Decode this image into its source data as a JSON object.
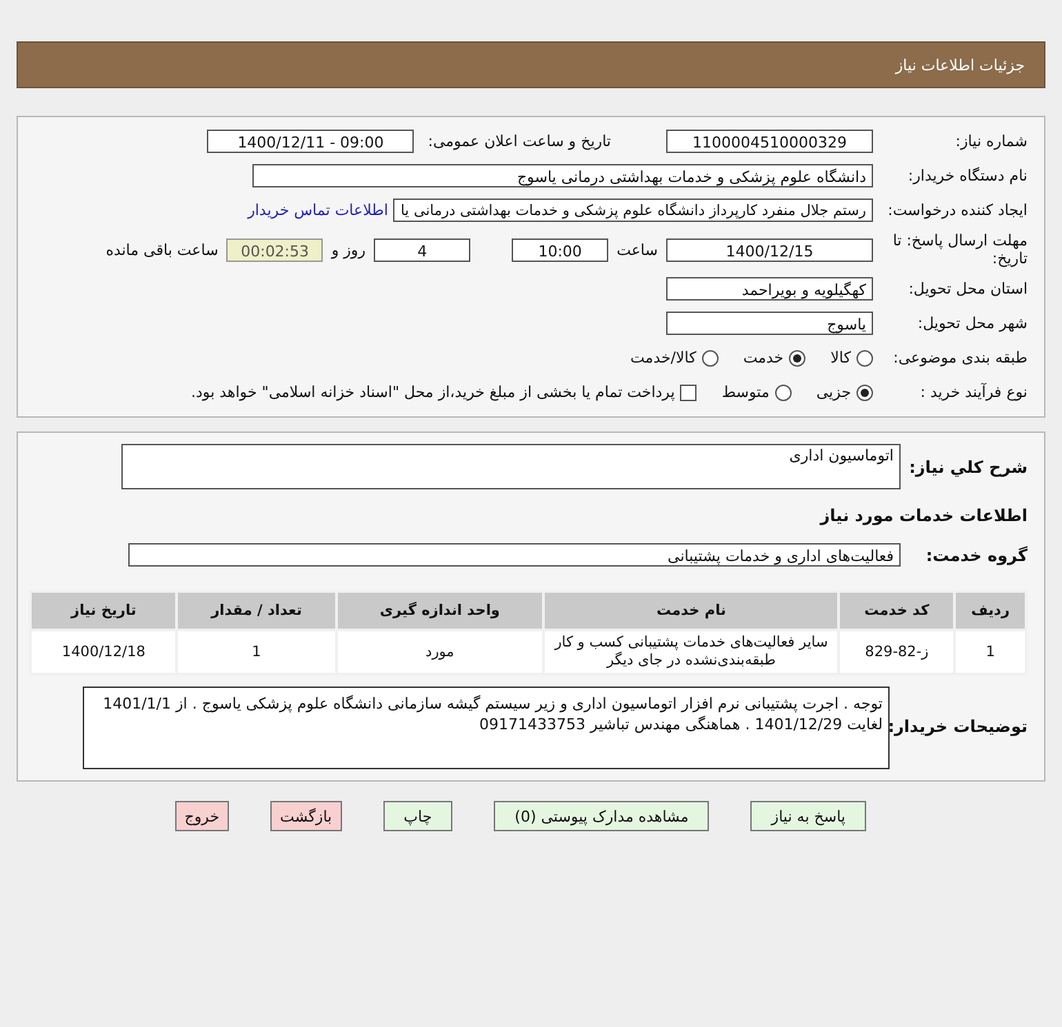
{
  "header": {
    "title": "جزئیات اطلاعات نیاز"
  },
  "details": {
    "need_number": {
      "label": "شماره نیاز:",
      "value": "1100004510000329"
    },
    "announce": {
      "label": "تاریخ و ساعت اعلان عمومی:",
      "value": "1400/12/11 - 09:00"
    },
    "buyer": {
      "label": "نام دستگاه خریدار:",
      "value": "دانشگاه علوم پزشکی و خدمات بهداشتی  درمانی یاسوج"
    },
    "creator": {
      "label": "ایجاد کننده درخواست:",
      "value": "رستم جلال منفرد کارپرداز دانشگاه علوم پزشکی و خدمات بهداشتی  درمانی یا",
      "link": "اطلاعات تماس خریدار"
    },
    "deadline": {
      "label": "مهلت ارسال پاسخ: تا تاریخ:",
      "date": "1400/12/15",
      "time_label": "ساعت",
      "time": "10:00",
      "days": "4",
      "days_label": "روز و",
      "remaining": "00:02:53",
      "remaining_label": "ساعت باقی مانده"
    },
    "province": {
      "label": "استان محل تحویل:",
      "value": "کهگیلویه و بویراحمد"
    },
    "city": {
      "label": "شهر محل تحویل:",
      "value": "یاسوج"
    },
    "category": {
      "label": "طبقه بندی موضوعی:",
      "options": [
        {
          "label": "کالا",
          "selected": false
        },
        {
          "label": "خدمت",
          "selected": true
        },
        {
          "label": "کالا/خدمت",
          "selected": false
        }
      ]
    },
    "process": {
      "label": "نوع فرآیند خرید :",
      "options": [
        {
          "label": "جزیی",
          "selected": true
        },
        {
          "label": "متوسط",
          "selected": false
        }
      ],
      "payment": {
        "label": "پرداخت تمام یا بخشی از مبلغ خرید،از محل \"اسناد خزانه اسلامی\" خواهد بود.",
        "checked": false
      }
    }
  },
  "summary": {
    "label": "شرح کلي نیاز:",
    "value": "اتوماسیون اداری"
  },
  "services_title": "اطلاعات خدمات مورد نیاز",
  "service_group": {
    "label": "گروه خدمت:",
    "value": "فعالیت‌های اداری و خدمات پشتیبانی"
  },
  "table": {
    "columns": [
      "ردیف",
      "کد خدمت",
      "نام خدمت",
      "واحد اندازه گیری",
      "تعداد / مقدار",
      "تاریخ نیاز"
    ],
    "rows": [
      [
        "1",
        "ز-82-829",
        "سایر فعالیت‌های خدمات پشتیبانی کسب و کار طبقه‌بندی‌نشده در جای دیگر",
        "مورد",
        "1",
        "1400/12/18"
      ]
    ]
  },
  "notes": {
    "label": "توضیحات خریدار:",
    "value": "توجه . اجرت پشتیبانی نرم افزار اتوماسیون اداری و زیر سیستم گیشه سازمانی دانشگاه علوم پزشکی یاسوج . از 1401/1/1 لغایت 1401/12/29 . هماهنگی مهندس تباشیر 09171433753"
  },
  "buttons": [
    {
      "label": "پاسخ به نیاز",
      "kind": "action"
    },
    {
      "label": "مشاهده مدارک پیوستی (0)",
      "kind": "action"
    },
    {
      "label": "چاپ",
      "kind": "action"
    },
    {
      "label": "بازگشت",
      "kind": "exit"
    },
    {
      "label": "خروج",
      "kind": "exit"
    }
  ]
}
